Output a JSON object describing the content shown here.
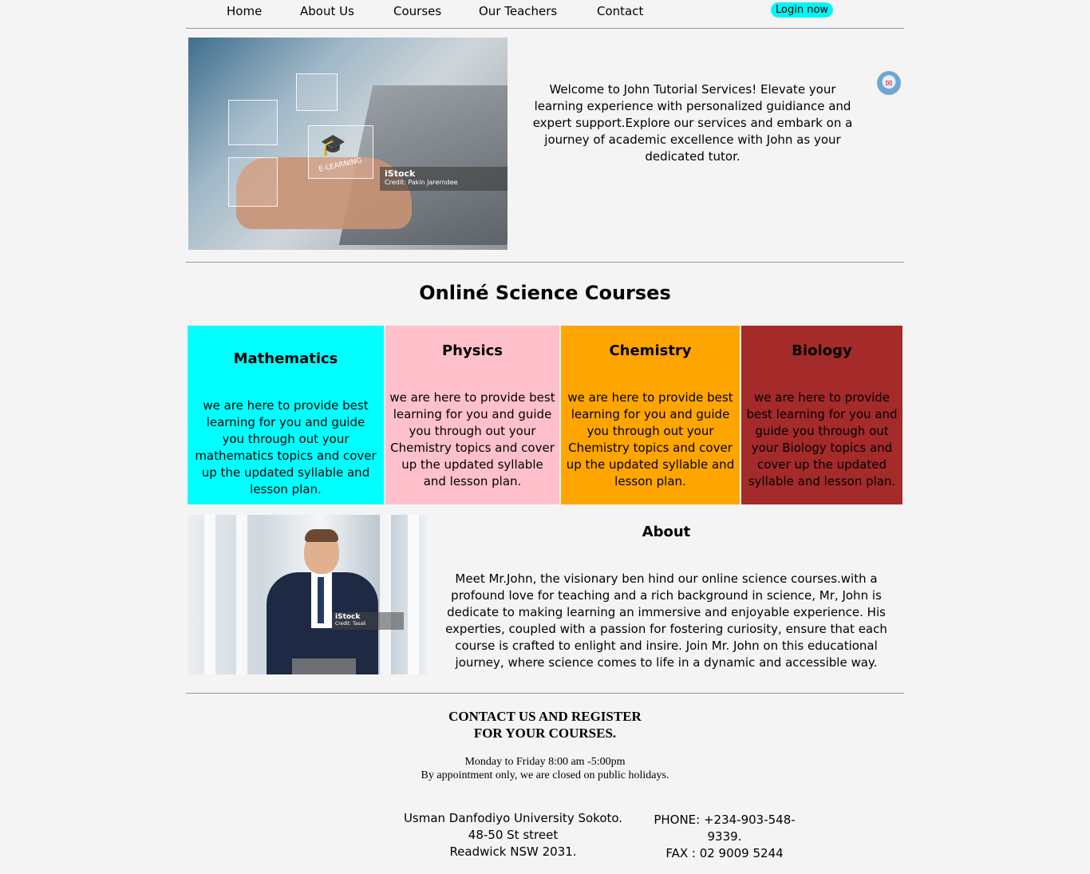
{
  "nav": {
    "items": [
      "Home",
      "About Us",
      "Courses",
      "Our Teachers",
      "Contact"
    ],
    "login": "Login now"
  },
  "hero": {
    "image_text": {
      "istock": "iStock",
      "credit": "Credit: Pakin Jarerndee",
      "elearning": "E-LEARNING"
    },
    "text": "Welcome to John Tutorial Services! Elevate your learning experience with personalized guidiance and expert support.Explore our services and embark on a journey of academic excellence with John as your dedicated tutor."
  },
  "courses": {
    "title": "Onliné Science Courses",
    "cards": [
      {
        "title": "Mathematics",
        "text": "we are here to provide best learning for you and guide you through out your mathematics topics and cover up the updated syllable and lesson plan.",
        "color": "#00ffff"
      },
      {
        "title": "Physics",
        "text": "we are here to provide best learning for you and guide you through out your Chemistry topics and cover up the updated syllable and lesson plan.",
        "color": "#ffc0cb"
      },
      {
        "title": "Chemistry",
        "text": "we are here to provide best learning for you and guide you through out your Chemistry topics and cover up the updated syllable and lesson plan.",
        "color": "#ffa500"
      },
      {
        "title": "Biology",
        "text": "we are here to provide best learning for you and guide you through out your Biology topics and cover up the updated syllable and lesson plan.",
        "color": "#a52a2a"
      }
    ]
  },
  "about": {
    "title": "About",
    "image_text": {
      "istock": "iStock",
      "credit": "Credit: Tasali"
    },
    "text": "Meet Mr.John, the visionary ben hind our online science courses.with a profound love for teaching and a rich background in science, Mr, John is dedicate to making learning an immersive and enjoyable experience. His experties, coupled with a passion for fostering curiosity, ensure that each course is crafted to enlight and insire. Join Mr. John on this educational journey, where science comes to life in a dynamic and accessible way."
  },
  "contact": {
    "title_line1": "CONTACT US AND REGISTER",
    "title_line2": "FOR YOUR COURSES.",
    "hours_line1": "Monday to Friday 8:00 am -5:00pm",
    "hours_line2": "By appointment only, we are closed on public holidays.",
    "address": [
      "Usman Danfodiyo University Sokoto.",
      "48-50 St street",
      "Readwick NSW 2031."
    ],
    "phone": "PHONE: +234-903-548-9339.",
    "fax": "FAX : 02 9009 5244"
  }
}
